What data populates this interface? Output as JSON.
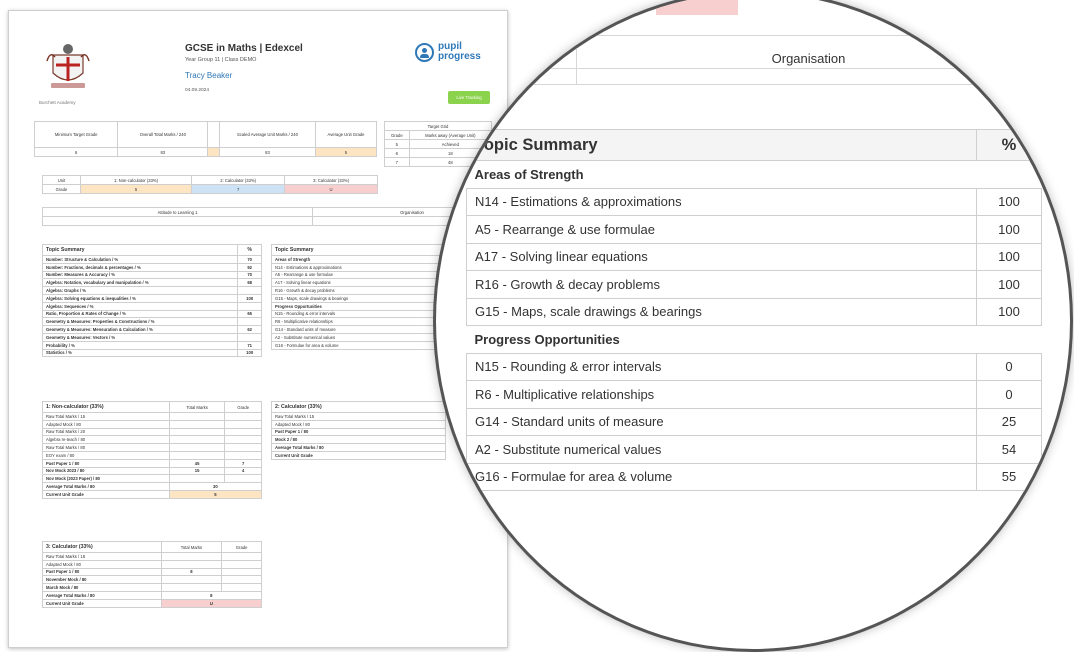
{
  "report": {
    "title": "GCSE in Maths | Edexcel",
    "year_class": "Year Group 11 | Class DEMO",
    "student": "Tracy Beaker",
    "date": "04.09.2024",
    "academy": "Burchett Academy",
    "logo_line1": "pupil",
    "logo_line2": "progress",
    "live_tracking": "Live Tracking",
    "summary": {
      "headers": [
        "Minimum Target Grade",
        "Overall Total Marks / 240",
        "Current Grade",
        "Scaled Average Unit Marks / 240",
        "Average Unit Grade"
      ],
      "values": [
        "6",
        "83",
        "5",
        "83",
        "5"
      ]
    },
    "target_grid": {
      "title": "Target Grid",
      "headers": [
        "Grade",
        "Marks away (Average Unit)"
      ],
      "rows": [
        [
          "5",
          "Achieved"
        ],
        [
          "6",
          "18"
        ],
        [
          "7",
          "48"
        ]
      ]
    },
    "units": {
      "headers": [
        "Unit",
        "1: Non-calculator (33%)",
        "2: Calculator (33%)",
        "3: Calculator (33%)"
      ],
      "row_label": "Grade",
      "values": [
        "5",
        "7",
        "U"
      ]
    },
    "attitude": {
      "left": "Attitude to Learning 1",
      "right": "Organisation"
    },
    "topic_summary": {
      "title": "Topic Summary",
      "pct": "%",
      "rows": [
        [
          "Number: Structure & Calculation / %",
          "70"
        ],
        [
          "Number: Fractions, decimals & percentages / %",
          "92"
        ],
        [
          "Number: Measures & Accuracy / %",
          "70"
        ],
        [
          "Algebra: Notation, vocabulary and manipulation / %",
          "68"
        ],
        [
          "Algebra: Graphs / %",
          ""
        ],
        [
          "Algebra: Solving equations & inequalities / %",
          "100"
        ],
        [
          "Algebra: Sequences / %",
          ""
        ],
        [
          "Ratio, Proportion & Rates of Change / %",
          "65"
        ],
        [
          "Geometry & Measures: Properties & Constructions / %",
          ""
        ],
        [
          "Geometry & Measures: Mensuration & Calculation / %",
          "62"
        ],
        [
          "Geometry & Measures: Vectors / %",
          ""
        ],
        [
          "Probability / %",
          "71"
        ],
        [
          "Statistics / %",
          "100"
        ]
      ]
    },
    "topic_right_small": {
      "title": "Topic Summary",
      "strength": "Areas of Strength",
      "strength_rows": [
        "N14 - Estimations & approximations",
        "A5 - Rearrange & use formulae",
        "A17 - Solving linear equations",
        "R16 - Growth & decay problems",
        "G15 - Maps, scale drawings & bearings"
      ],
      "progress": "Progress Opportunities",
      "progress_rows": [
        "N15 - Rounding & error intervals",
        "R6 - Multiplicative relationships",
        "G14 - Standard units of measure",
        "A2 - Substitute numerical values",
        "G16 - Formulae for area & volume"
      ]
    },
    "unit1": {
      "title": "1: Non-calculator (33%)",
      "col1": "Total Marks",
      "col2": "Grade",
      "rows": [
        [
          "Raw Total Marks / 15",
          "",
          ""
        ],
        [
          "Adapted Mock / 80",
          "",
          ""
        ],
        [
          "Raw Total Marks / 20",
          "",
          ""
        ],
        [
          "Algebra re-teach / 80",
          "",
          ""
        ],
        [
          "Raw Total Marks / 80",
          "",
          ""
        ],
        [
          "EOY exam / 80",
          "",
          ""
        ]
      ],
      "bold_rows": [
        [
          "Past Paper 1 / 80",
          "45",
          "7"
        ],
        [
          "Nov Mock 2023 / 80",
          "15",
          "4"
        ],
        [
          "Nov Mock (2023 Paper) / 80",
          "",
          ""
        ]
      ],
      "avg_label": "Average Total Marks / 80",
      "avg_value": "30",
      "grade_label": "Current Unit Grade",
      "grade_value": "5"
    },
    "unit2": {
      "title": "2: Calculator (33%)",
      "rows": [
        "Raw Total Marks / 15",
        "Adapted Mock / 80"
      ],
      "bold_rows": [
        "Past Paper 1 / 80",
        "Mock 2 / 80"
      ],
      "avg_label": "Average Total Marks / 80",
      "grade_label": "Current Unit Grade"
    },
    "unit3": {
      "title": "3: Calculator (33%)",
      "col1": "Total Marks",
      "col2": "Grade",
      "rows": [
        [
          "Raw Total Marks / 18",
          "",
          ""
        ],
        [
          "Adapted Mock / 80",
          "",
          ""
        ]
      ],
      "bold_rows": [
        [
          "Past Paper 1 / 80",
          "8",
          ""
        ],
        [
          "November Mock / 80",
          "",
          ""
        ],
        [
          "March Mock / 80",
          "",
          ""
        ]
      ],
      "avg_label": "Average Total Marks / 80",
      "avg_value": "8",
      "grade_label": "Current Unit Grade",
      "grade_value": "U"
    }
  },
  "zoom": {
    "organisation": "Organisation",
    "title": "Topic Summary",
    "pct": "%",
    "strength": "Areas of Strength",
    "strength_rows": [
      [
        "N14 - Estimations & approximations",
        "100"
      ],
      [
        "A5 - Rearrange & use formulae",
        "100"
      ],
      [
        "A17 - Solving linear equations",
        "100"
      ],
      [
        "R16 - Growth & decay problems",
        "100"
      ],
      [
        "G15 - Maps, scale drawings & bearings",
        "100"
      ]
    ],
    "progress": "Progress Opportunities",
    "progress_rows": [
      [
        "N15 - Rounding & error intervals",
        "0"
      ],
      [
        "R6 - Multiplicative relationships",
        "0"
      ],
      [
        "G14 - Standard units of measure",
        "25"
      ],
      [
        "A2 - Substitute numerical values",
        "54"
      ],
      [
        "G16 - Formulae for area & volume",
        "55"
      ]
    ]
  }
}
